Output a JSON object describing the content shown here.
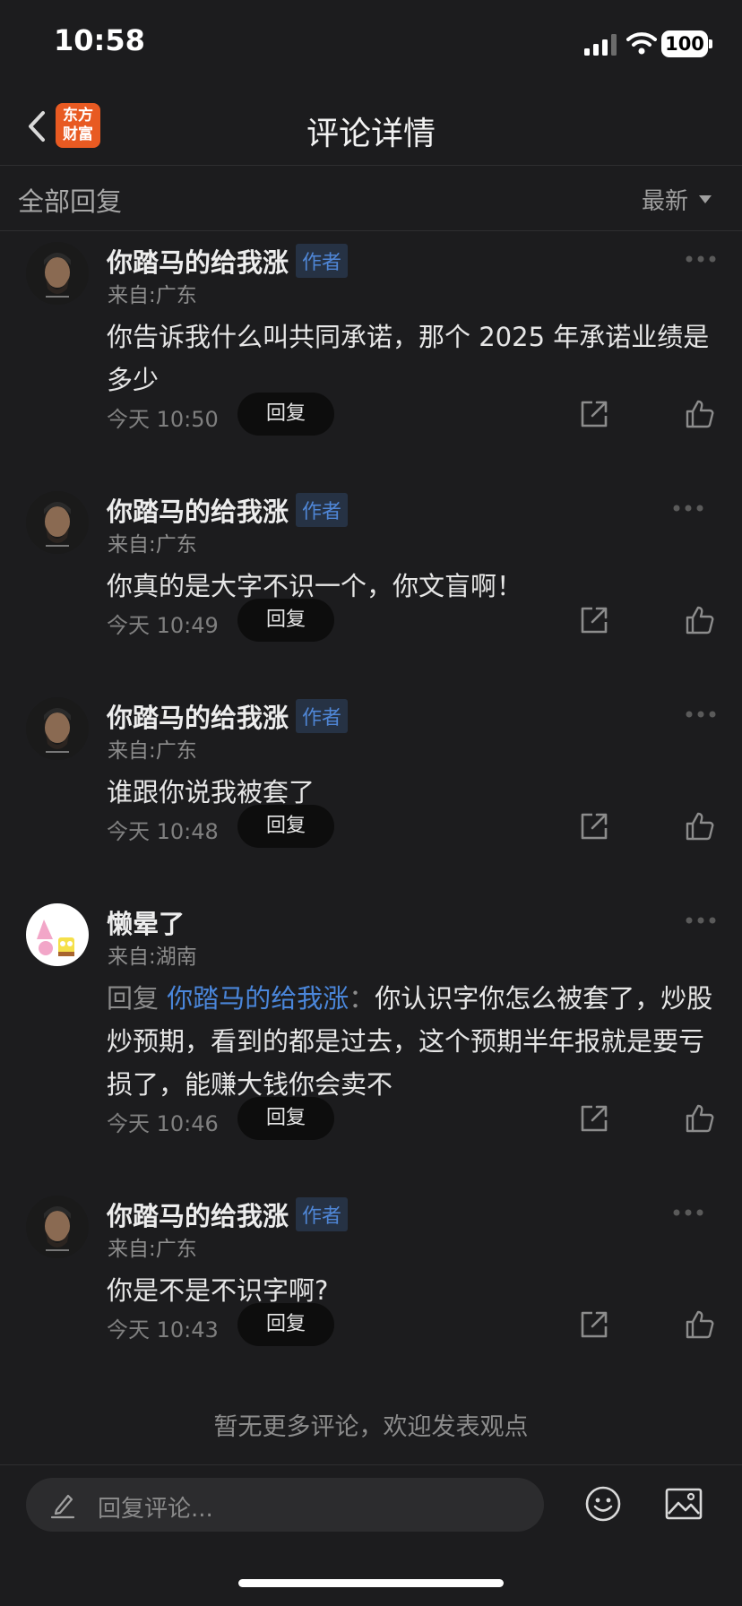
{
  "status_bar": {
    "time": "10:58",
    "battery": "100"
  },
  "nav": {
    "title": "评论详情",
    "logo_line1": "东方",
    "logo_line2": "财富"
  },
  "filter": {
    "label": "全部回复",
    "sort": "最新"
  },
  "reply_button_label": "回复",
  "author_badge": "作者",
  "comments": [
    {
      "username": "你踏马的给我涨",
      "is_author": true,
      "location": "来自:广东",
      "text": "你告诉我什么叫共同承诺，那个 2025 年承诺业绩是多少",
      "time": "今天 10:50"
    },
    {
      "username": "你踏马的给我涨",
      "is_author": true,
      "location": "来自:广东",
      "text": "你真的是大字不识一个，你文盲啊！",
      "time": "今天 10:49"
    },
    {
      "username": "你踏马的给我涨",
      "is_author": true,
      "location": "来自:广东",
      "text": "谁跟你说我被套了",
      "time": "今天 10:48"
    },
    {
      "username": "懒晕了",
      "is_author": false,
      "location": "来自:湖南",
      "reply_prefix": "回复",
      "reply_to": "你踏马的给我涨",
      "reply_sep": "：",
      "text": "你认识字你怎么被套了，炒股炒预期，看到的都是过去，这个预期半年报就是要亏损了，能赚大钱你会卖不",
      "time": "今天 10:46"
    },
    {
      "username": "你踏马的给我涨",
      "is_author": true,
      "location": "来自:广东",
      "text": "你是不是不识字啊?",
      "time": "今天 10:43"
    }
  ],
  "footer_note": "暂无更多评论，欢迎发表观点",
  "input": {
    "placeholder": "回复评论..."
  },
  "colors": {
    "background": "#1c1c1e",
    "accent_blue": "#4a86da",
    "logo_orange": "#e85a22"
  }
}
